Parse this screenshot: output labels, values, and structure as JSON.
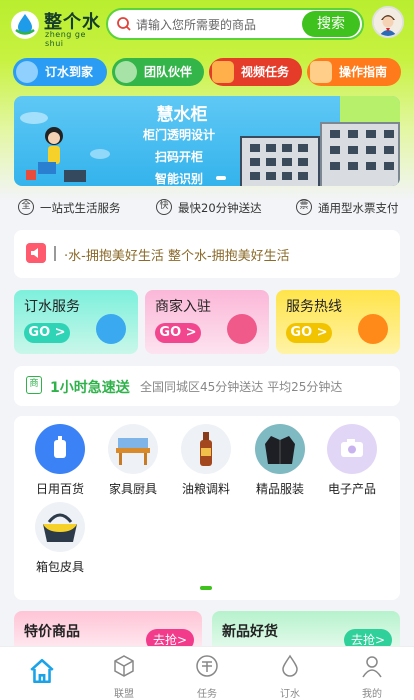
{
  "header": {
    "logo_title": "整个水",
    "logo_subtitle": "zheng ge shui",
    "search_placeholder": "请输入您所需要的商品",
    "search_button": "搜索"
  },
  "pills": [
    {
      "label": "订水到家",
      "icon": "water-delivery-icon"
    },
    {
      "label": "团队伙伴",
      "icon": "team-icon"
    },
    {
      "label": "视频任务",
      "icon": "video-icon"
    },
    {
      "label": "操作指南",
      "icon": "guide-icon"
    }
  ],
  "banner": {
    "title": "慧水柜",
    "line1": "柜门透明设计",
    "line2": "扫码开柜",
    "line3": "智能识别"
  },
  "features": [
    {
      "icon": "全",
      "label": "一站式生活服务"
    },
    {
      "icon": "快",
      "label": "最快20分钟送达"
    },
    {
      "icon": "票",
      "label": "通用型水票支付"
    }
  ],
  "notice": {
    "text": "·水-拥抱美好生活     整个水-拥抱美好生活"
  },
  "services": [
    {
      "title": "订水服务",
      "go": "GO >"
    },
    {
      "title": "商家入驻",
      "go": "GO >"
    },
    {
      "title": "服务热线",
      "go": "GO >"
    }
  ],
  "express": {
    "badge": "商",
    "title": "1小时急速送",
    "desc": "全国同城区45分钟送达 平均25分钟达"
  },
  "categories": [
    {
      "label": "日用百货"
    },
    {
      "label": "家具厨具"
    },
    {
      "label": "油粮调料"
    },
    {
      "label": "精品服装"
    },
    {
      "label": "电子产品"
    },
    {
      "label": "箱包皮具"
    }
  ],
  "promos": [
    {
      "title": "特价商品",
      "button": "去抢>"
    },
    {
      "title": "新品好货",
      "button": "去抢>"
    }
  ],
  "tabbar": [
    {
      "label": "",
      "icon": "home-icon"
    },
    {
      "label": "联盟",
      "icon": "alliance-icon"
    },
    {
      "label": "任务",
      "icon": "task-icon"
    },
    {
      "label": "订水",
      "icon": "water-drop-icon"
    },
    {
      "label": "我的",
      "icon": "user-icon"
    }
  ],
  "colors": {
    "brand_green": "#3fc21d",
    "active_tab": "#1aa3e8"
  }
}
